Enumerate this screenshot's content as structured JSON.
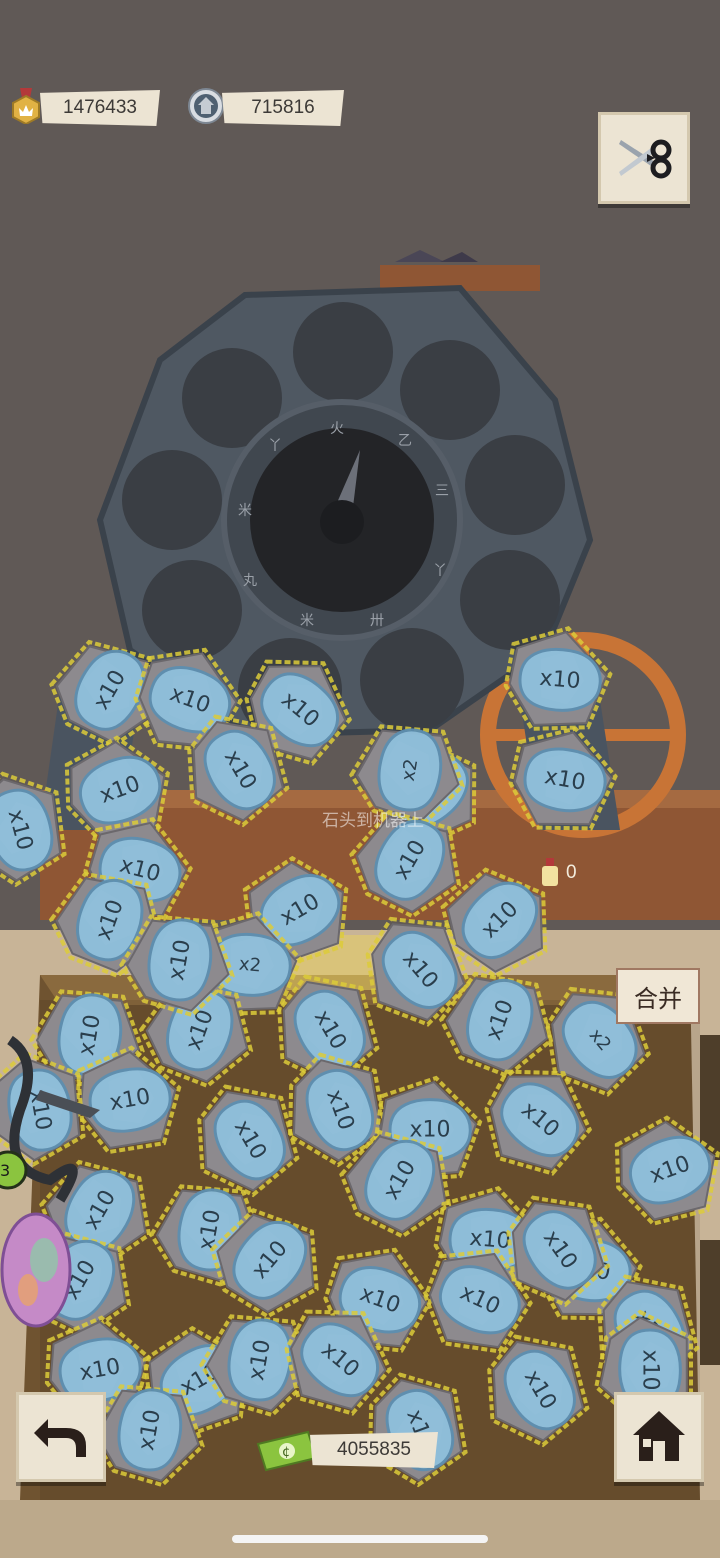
{
  "hud": {
    "medals": "1476433",
    "gears": "715816",
    "money": "4055835",
    "stone_count": "0",
    "icons": {
      "medals": "medal-icon",
      "gears": "gear-coin-icon",
      "money": "banknote-icon",
      "scissors": "scissors-icon",
      "back": "back-arrow-icon",
      "home": "house-icon"
    }
  },
  "machine": {
    "dial_hint": "石头到机器上",
    "merge_label": "合并"
  },
  "stones": {
    "label_common": "x10",
    "label_rare": "x2",
    "colors": {
      "chip": "#8fc0dc",
      "stone": "#8d8a8e",
      "glow": "#dccb3a"
    }
  },
  "colors": {
    "background": "#605956",
    "floor": "#c8b497",
    "wood": "#8f5634",
    "machine": "#4f5862",
    "wheel": "#c87436"
  }
}
